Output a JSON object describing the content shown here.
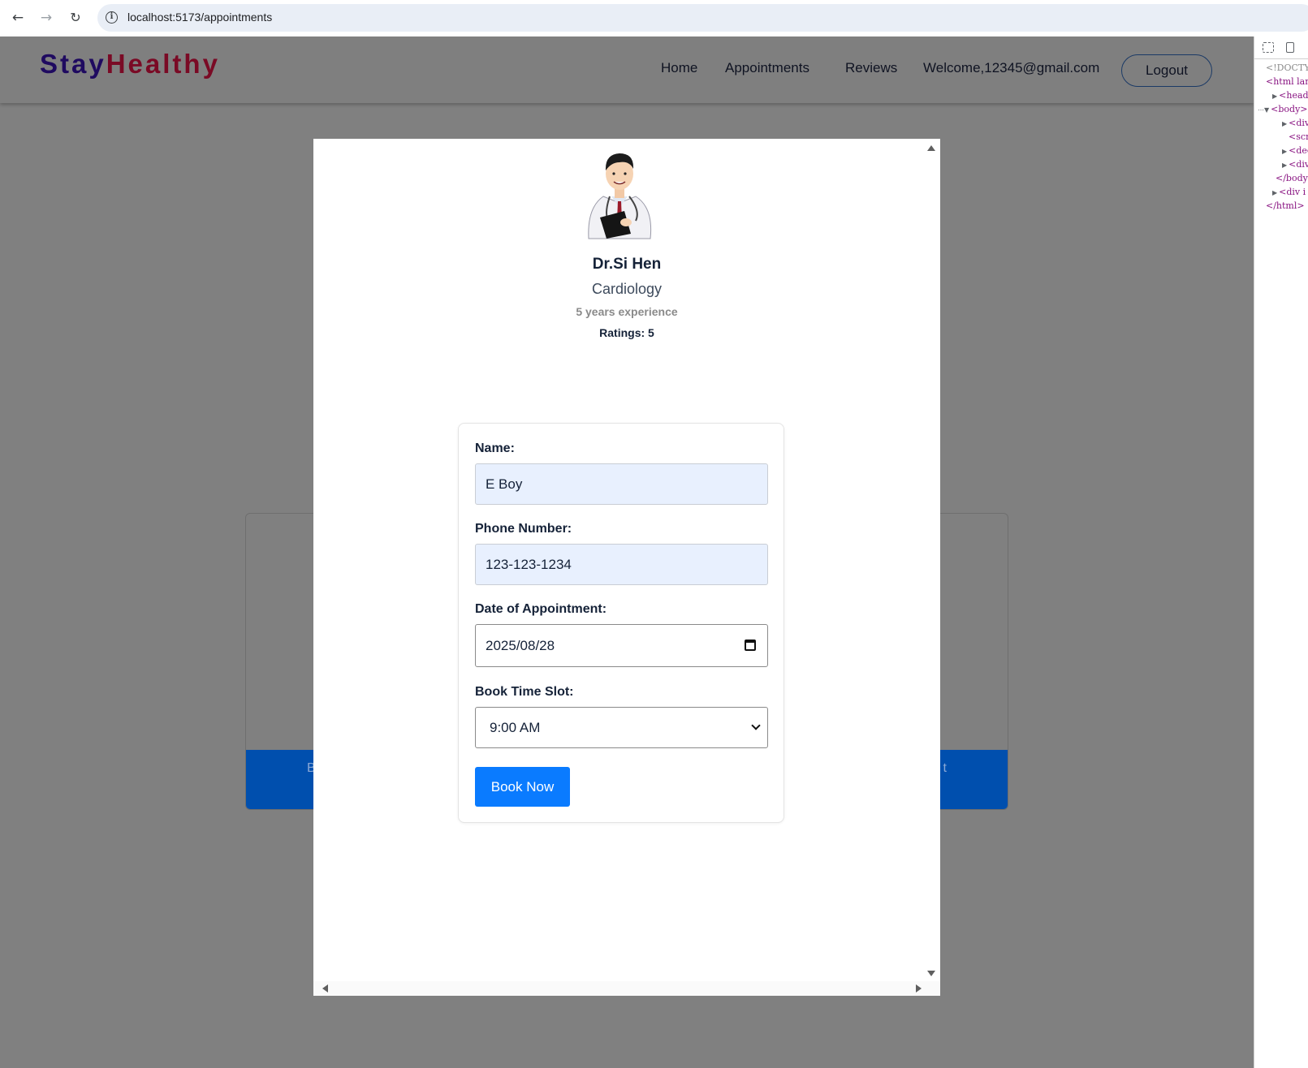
{
  "browser": {
    "url": "localhost:5173/appointments"
  },
  "header": {
    "logo_part1": "Stay",
    "logo_part2": "Healthy",
    "nav": {
      "home": "Home",
      "appointments": "Appointments",
      "reviews": "Reviews",
      "welcome": "Welcome,12345@gmail.com"
    },
    "logout_label": "Logout"
  },
  "background_card": {
    "footer_left": "B",
    "footer_right": "t"
  },
  "doctor": {
    "name": "Dr.Si Hen",
    "speciality": "Cardiology",
    "experience": "5 years experience",
    "ratings": "Ratings: 5"
  },
  "form": {
    "name_label": "Name:",
    "name_value": "E Boy",
    "phone_label": "Phone Number:",
    "phone_value": "123-123-1234",
    "date_label": "Date of Appointment:",
    "date_value": "2025/08/28",
    "slot_label": "Book Time Slot:",
    "slot_value": "9:00 AM",
    "submit_label": "Book Now"
  },
  "devtools": {
    "lines": [
      "<!DOCTYPE",
      "<html lan",
      "<head>",
      "<body>",
      "<div",
      "<scri",
      "<dee",
      "<div",
      "</body>",
      "<div i",
      "</html>"
    ]
  },
  "colors": {
    "logo_stay": "#1f0a60",
    "logo_healthy": "#7a0a25",
    "primary_button": "#0a7bff",
    "card_footer": "#004fae",
    "overlay": "#808080"
  }
}
